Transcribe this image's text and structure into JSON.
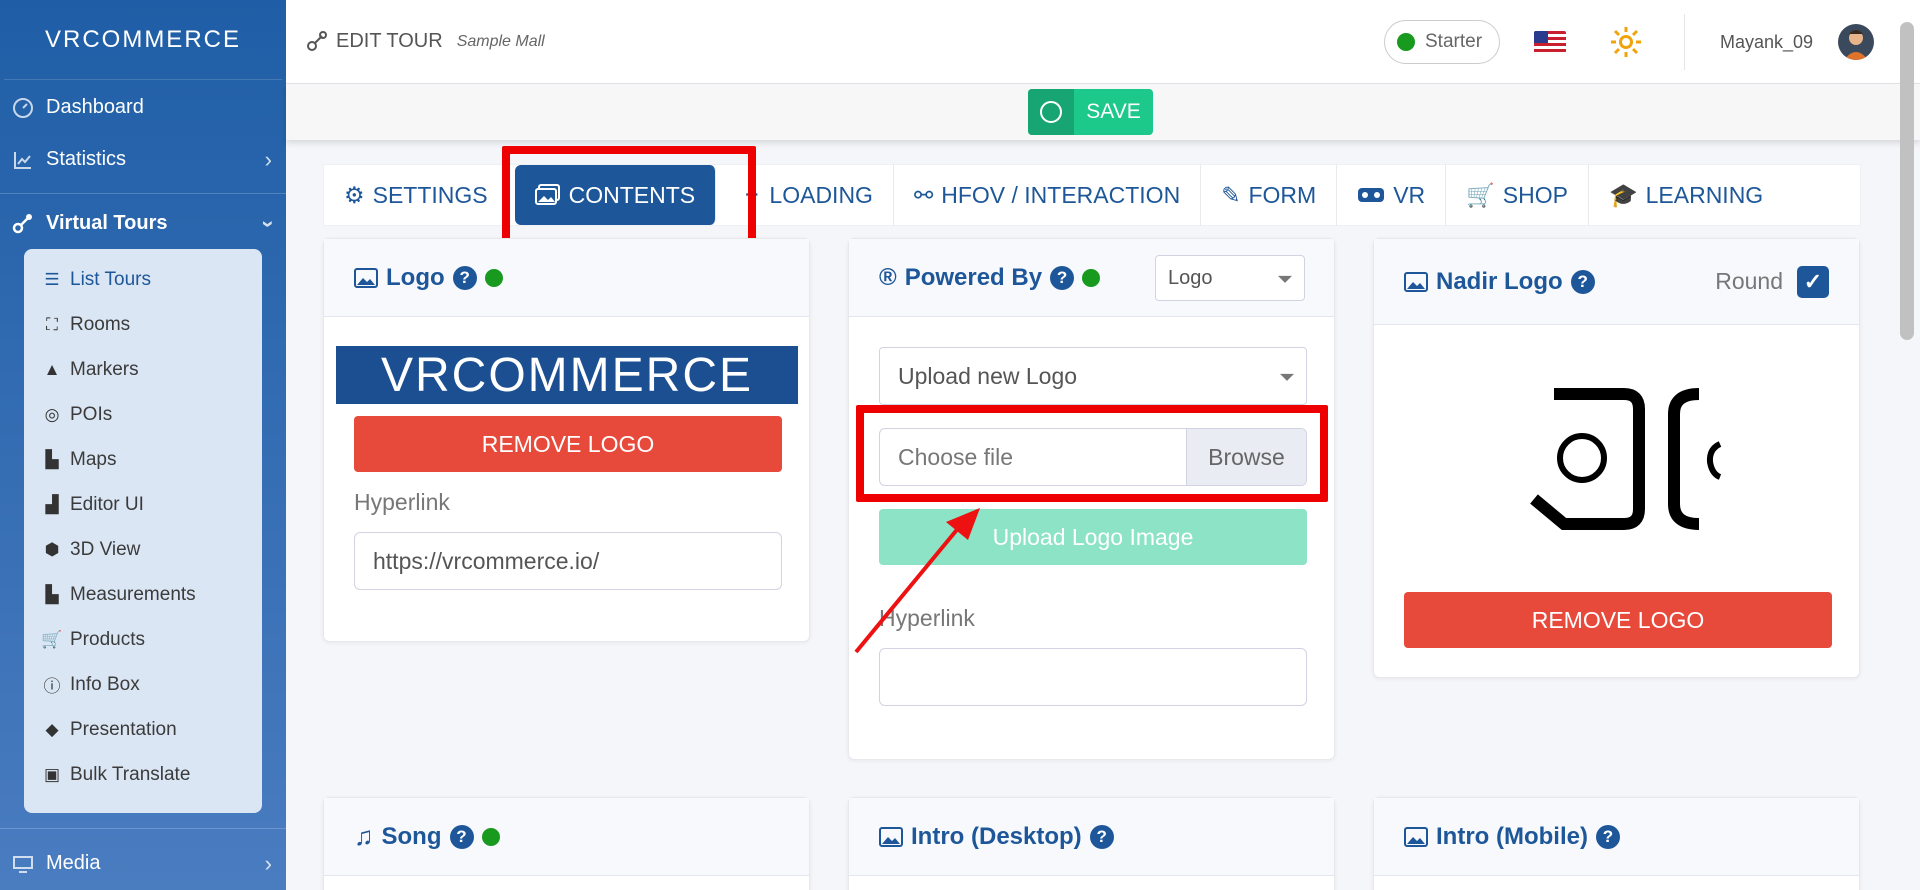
{
  "brand": "VRCOMMERCE",
  "sidebar": {
    "items": [
      {
        "label": "Dashboard",
        "icon": "dashboard-icon"
      },
      {
        "label": "Statistics",
        "icon": "chart-icon"
      },
      {
        "label": "Virtual Tours",
        "icon": "tours-icon"
      }
    ],
    "sub_items": [
      {
        "label": "List Tours",
        "icon": "list-icon"
      },
      {
        "label": "Rooms",
        "icon": "rooms-icon"
      },
      {
        "label": "Markers",
        "icon": "markers-icon"
      },
      {
        "label": "POIs",
        "icon": "poi-icon"
      },
      {
        "label": "Maps",
        "icon": "map-icon"
      },
      {
        "label": "Editor UI",
        "icon": "editor-icon"
      },
      {
        "label": "3D View",
        "icon": "cube-icon"
      },
      {
        "label": "Measurements",
        "icon": "ruler-icon"
      },
      {
        "label": "Products",
        "icon": "cart-icon"
      },
      {
        "label": "Info Box",
        "icon": "info-icon"
      },
      {
        "label": "Presentation",
        "icon": "presentation-icon"
      },
      {
        "label": "Bulk Translate",
        "icon": "translate-icon"
      }
    ],
    "media": "Media"
  },
  "topbar": {
    "title": "EDIT TOUR",
    "tour_name": "Sample Mall",
    "plan": "Starter",
    "username": "Mayank_09"
  },
  "save_label": "SAVE",
  "tabs": [
    "SETTINGS",
    "CONTENTS",
    "LOADING",
    "HFOV / INTERACTION",
    "FORM",
    "VR",
    "SHOP",
    "LEARNING"
  ],
  "logo_card": {
    "title": "Logo",
    "logo_text": "VRCOMMERCE",
    "remove": "REMOVE LOGO",
    "hyperlink_label": "Hyperlink",
    "hyperlink_value": "https://vrcommerce.io/"
  },
  "powered_card": {
    "title": "Powered By",
    "select_value": "Logo",
    "upload_select": "Upload new Logo",
    "choose_file": "Choose file",
    "browse": "Browse",
    "upload_btn": "Upload Logo Image",
    "hyperlink_label": "Hyperlink",
    "hyperlink_value": ""
  },
  "nadir_card": {
    "title": "Nadir Logo",
    "round_label": "Round",
    "remove": "REMOVE LOGO"
  },
  "bottom_cards": [
    "Song",
    "Intro (Desktop)",
    "Intro (Mobile)"
  ],
  "colors": {
    "primary": "#1e5799",
    "danger": "#e74a3b",
    "success": "#1cc88a",
    "highlight": "#ee0000"
  }
}
